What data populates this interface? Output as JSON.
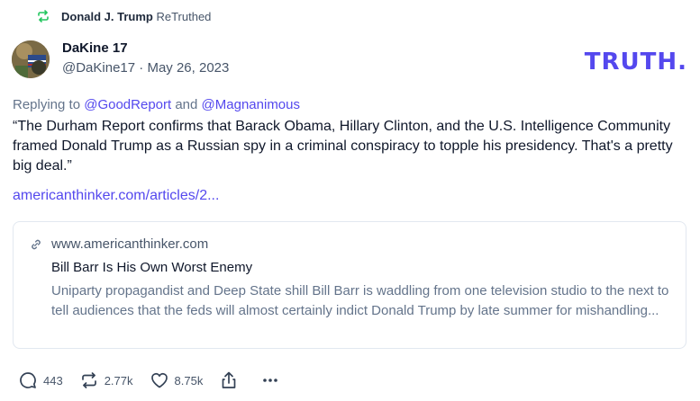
{
  "retruth": {
    "name": "Donald J. Trump",
    "verb": "ReTruthed"
  },
  "author": {
    "display_name": "DaKine 17",
    "handle": "@DaKine17",
    "separator": "·",
    "date": "May 26, 2023"
  },
  "brand": {
    "logo_text": "TRUTH."
  },
  "replying": {
    "prefix": "Replying to",
    "mention1": "@GoodReport",
    "joiner": "and",
    "mention2": "@Magnanimous"
  },
  "post": {
    "text": "“The Durham Report confirms that Barack Obama, Hillary Clinton, and the U.S. Intelligence Community framed Donald Trump as a Russian spy in a criminal conspiracy to topple his presidency.  That's a pretty big deal.”",
    "link": "americanthinker.com/articles/2..."
  },
  "card": {
    "domain": "www.americanthinker.com",
    "title": "Bill Barr Is His Own Worst Enemy",
    "description": "Uniparty propagandist and Deep State shill Bill Barr is waddling from one television studio to the next to tell audiences that the feds will almost certainly indict Donald Trump by late summer for mishandling..."
  },
  "actions": {
    "replies": "443",
    "retruths": "2.77k",
    "likes": "8.75k"
  },
  "colors": {
    "accent": "#5448ee",
    "retruth_green": "#22c55e",
    "muted": "#64748b"
  }
}
